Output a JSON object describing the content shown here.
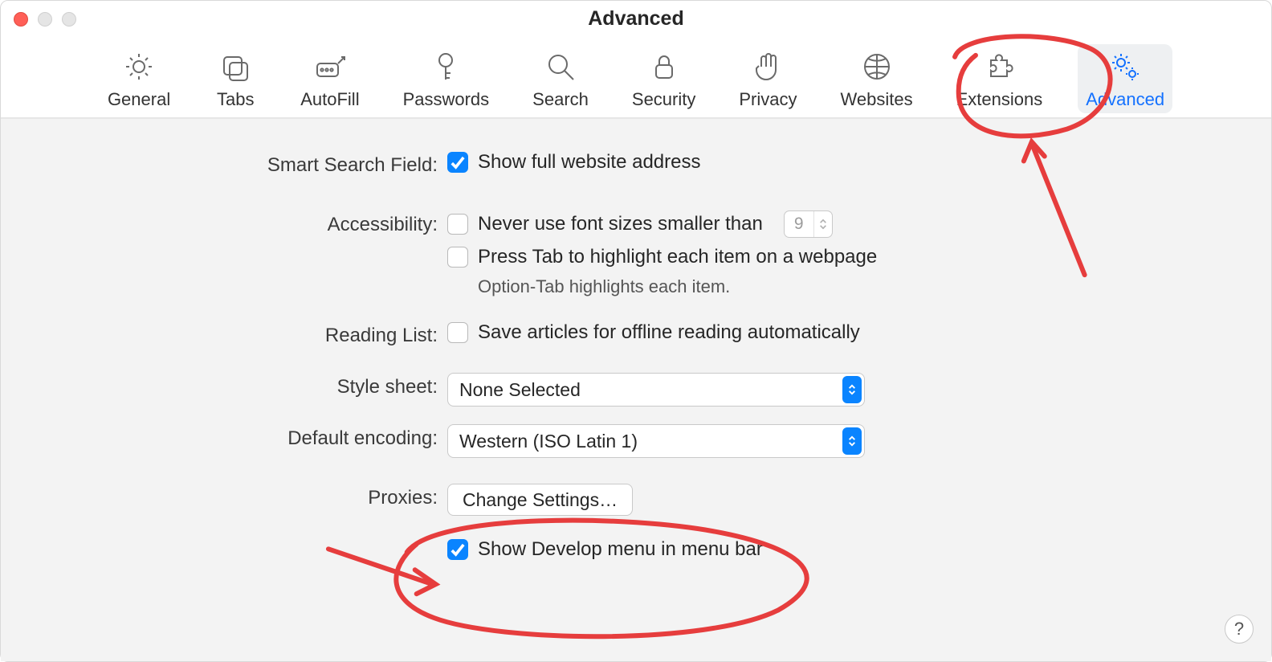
{
  "window_title": "Advanced",
  "tabs": [
    {
      "id": "general",
      "label": "General",
      "icon": "gear-icon",
      "active": false
    },
    {
      "id": "tabs",
      "label": "Tabs",
      "icon": "tabs-icon",
      "active": false
    },
    {
      "id": "autofill",
      "label": "AutoFill",
      "icon": "autofill-icon",
      "active": false
    },
    {
      "id": "passwords",
      "label": "Passwords",
      "icon": "key-icon",
      "active": false
    },
    {
      "id": "search",
      "label": "Search",
      "icon": "search-icon",
      "active": false
    },
    {
      "id": "security",
      "label": "Security",
      "icon": "lock-icon",
      "active": false
    },
    {
      "id": "privacy",
      "label": "Privacy",
      "icon": "hand-icon",
      "active": false
    },
    {
      "id": "websites",
      "label": "Websites",
      "icon": "globe-icon",
      "active": false
    },
    {
      "id": "extensions",
      "label": "Extensions",
      "icon": "puzzle-icon",
      "active": false
    },
    {
      "id": "advanced",
      "label": "Advanced",
      "icon": "gears-icon",
      "active": true
    }
  ],
  "settings": {
    "smart_search": {
      "label": "Smart Search Field:",
      "show_full_address": {
        "text": "Show full website address",
        "checked": true
      }
    },
    "accessibility": {
      "label": "Accessibility:",
      "min_font": {
        "text": "Never use font sizes smaller than",
        "checked": false,
        "value": "9"
      },
      "tab_highlight": {
        "text": "Press Tab to highlight each item on a webpage",
        "checked": false
      },
      "hint": "Option-Tab highlights each item."
    },
    "reading_list": {
      "label": "Reading List:",
      "save_offline": {
        "text": "Save articles for offline reading automatically",
        "checked": false
      }
    },
    "style_sheet": {
      "label": "Style sheet:",
      "value": "None Selected"
    },
    "default_encoding": {
      "label": "Default encoding:",
      "value": "Western (ISO Latin 1)"
    },
    "proxies": {
      "label": "Proxies:",
      "button": "Change Settings…"
    },
    "develop_menu": {
      "text": "Show Develop menu in menu bar",
      "checked": true
    }
  },
  "help_button": "?",
  "colors": {
    "accent": "#0a84ff",
    "annotation": "#e63d3d"
  }
}
